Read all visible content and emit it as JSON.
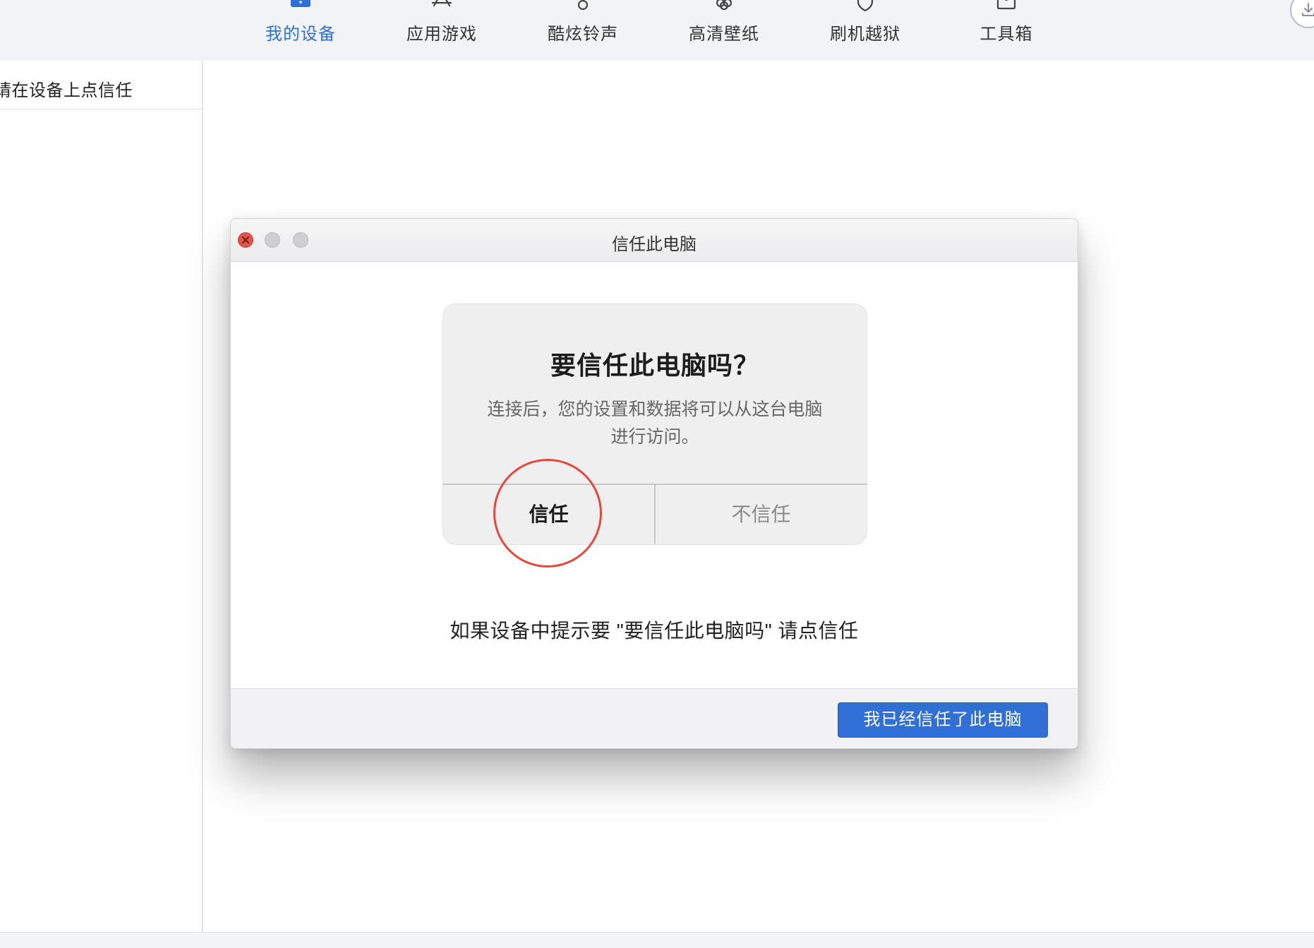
{
  "nav": {
    "items": [
      {
        "label": "我的设备",
        "icon": "device-icon",
        "active": true
      },
      {
        "label": "应用游戏",
        "icon": "app-store-icon",
        "active": false
      },
      {
        "label": "酷炫铃声",
        "icon": "ringtone-icon",
        "active": false
      },
      {
        "label": "高清壁纸",
        "icon": "wallpaper-icon",
        "active": false
      },
      {
        "label": "刷机越狱",
        "icon": "shield-icon",
        "active": false
      },
      {
        "label": "工具箱",
        "icon": "toolbox-icon",
        "active": false
      }
    ],
    "download_icon": "download-icon",
    "active_color": "#2f6fd6"
  },
  "sidebar": {
    "hint": "请在设备上点信任"
  },
  "dialog": {
    "title": "信任此电脑",
    "alert": {
      "title": "要信任此电脑吗？",
      "message": "连接后，您的设置和数据将可以从这台电脑进行访问。",
      "trust_label": "信任",
      "distrust_label": "不信任"
    },
    "instruction": "如果设备中提示要 \"要信任此电脑吗\" 请点信任",
    "confirm_label": "我已经信任了此电脑",
    "confirm_color": "#2f6fd6",
    "highlight_color": "#e34a3c"
  }
}
